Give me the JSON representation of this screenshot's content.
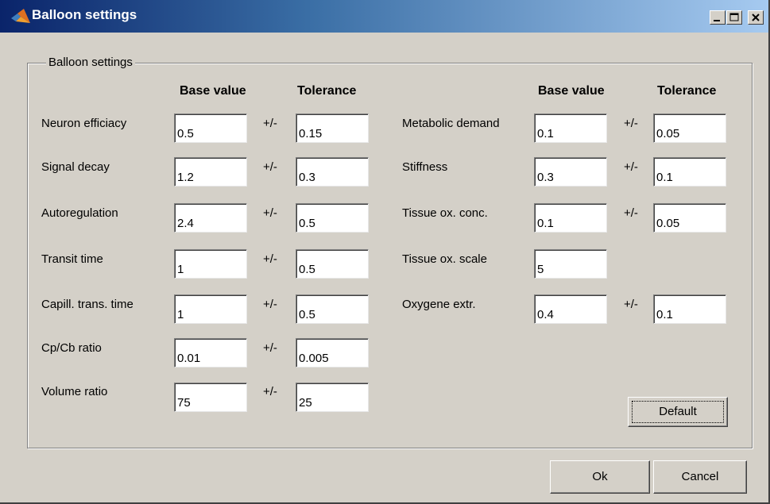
{
  "window": {
    "title": "Balloon settings"
  },
  "group": {
    "title": "Balloon settings",
    "col_headers": {
      "left_base": "Base value",
      "left_tol": "Tolerance",
      "right_base": "Base value",
      "right_tol": "Tolerance"
    },
    "plus_minus": "+/-",
    "left": [
      {
        "label": "Neuron efficiacy",
        "base": "0.5",
        "tol": "0.15"
      },
      {
        "label": "Signal decay",
        "base": "1.2",
        "tol": "0.3"
      },
      {
        "label": "Autoregulation",
        "base": "2.4",
        "tol": "0.5"
      },
      {
        "label": "Transit time",
        "base": "1",
        "tol": "0.5"
      },
      {
        "label": "Capill. trans. time",
        "base": "1",
        "tol": "0.5"
      },
      {
        "label": "Cp/Cb ratio",
        "base": "0.01",
        "tol": "0.005"
      },
      {
        "label": "Volume ratio",
        "base": "75",
        "tol": "25"
      }
    ],
    "right": [
      {
        "label": "Metabolic demand",
        "base": "0.1",
        "tol": "0.05"
      },
      {
        "label": "Stiffness",
        "base": "0.3",
        "tol": "0.1"
      },
      {
        "label": "Tissue ox. conc.",
        "base": "0.1",
        "tol": "0.05"
      },
      {
        "label": "Tissue ox. scale",
        "base": "5"
      },
      {
        "label": "Oxygene extr.",
        "base": "0.4",
        "tol": "0.1"
      }
    ]
  },
  "buttons": {
    "default": "Default",
    "ok": "Ok",
    "cancel": "Cancel"
  }
}
